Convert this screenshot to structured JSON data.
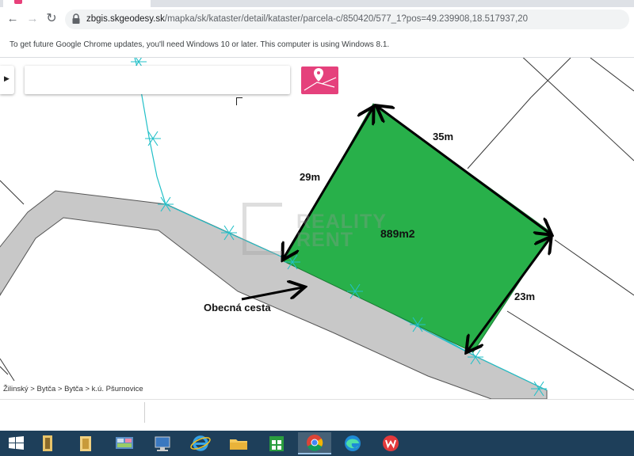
{
  "browser": {
    "url_domain": "zbgis.skgeodesy.sk",
    "url_path": "/mapka/sk/kataster/detail/kataster/parcela-c/850420/577_1?pos=49.239908,18.517937,20",
    "infobar_text": "To get future Google Chrome updates, you'll need Windows 10 or later. This computer is using Windows 8.1."
  },
  "map": {
    "edge_labels": {
      "top": "35m",
      "left": "29m",
      "right": "23m"
    },
    "area_label": "889m2",
    "road_label": "Obecná cesta",
    "watermark": {
      "line1": "REALITY",
      "line2": "RENT"
    },
    "breadcrumb": "Žilinský > Bytča > Bytča > k.ú. Pšurnovice"
  },
  "colors": {
    "parcel_fill": "#28b04a",
    "road_fill": "#c8c8c8",
    "boundary_cyan": "#22c0c8",
    "parcel_button": "#e5417c",
    "taskbar": "#1e3f5a"
  },
  "taskbar": {
    "items": [
      "start-icon",
      "file-manager-icon",
      "folder-icon",
      "control-panel-icon",
      "computer-icon",
      "internet-explorer-icon",
      "file-explorer-icon",
      "store-icon",
      "chrome-icon",
      "edge-icon",
      "wps-office-icon"
    ]
  }
}
